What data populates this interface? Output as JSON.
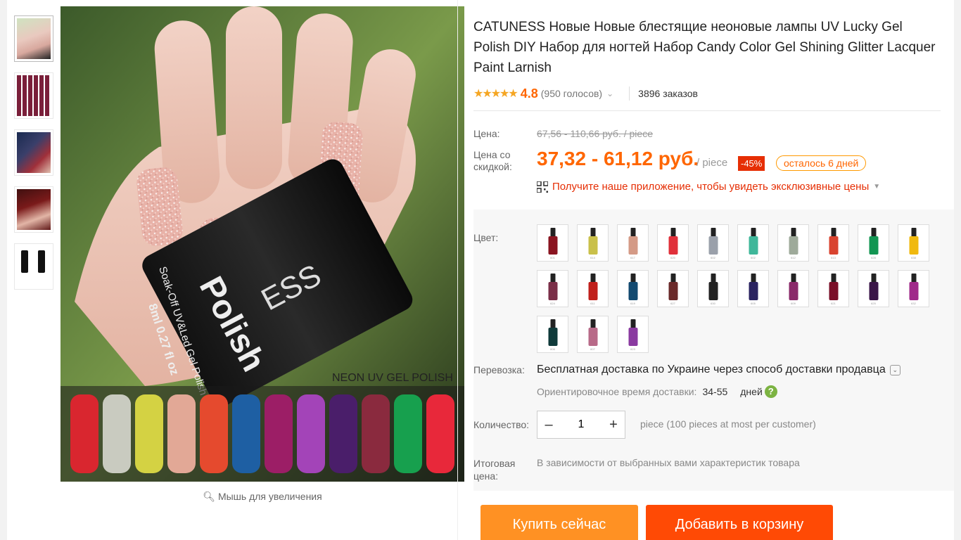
{
  "product": {
    "title": "CATUNESS Новые Новые блестящие неоновые лампы UV Lucky Gel Polish DIY Набор для ногтей Набор Candy Color Gel Shining Glitter Lacquer Paint Larnish",
    "rating": "4.8",
    "votes": "(950 голосов)",
    "orders": "3896 заказов"
  },
  "gallery": {
    "zoom_hint": "Мышь для увеличения",
    "image_caption": "NEON UV GEL POLISH",
    "bottle_text_1": "Soak-Off UV&Led Gel Polish",
    "bottle_text_2": "8ml 0.27 fl oz",
    "bottle_brand": "ESS",
    "bottle_word": "Polish",
    "thumbnails": [
      "hand-nails",
      "bottles-grid",
      "nails-red",
      "hand-dark",
      "two-bottles"
    ]
  },
  "price": {
    "label": "Цена:",
    "old": "67,56 - 110,66 руб. / piece",
    "discount_label": "Цена со скидкой:",
    "new": "37,32 - 61,12 руб.",
    "per_piece": "/ piece",
    "discount_pct": "-45%",
    "days_left": "осталось 6 дней",
    "app_promo": "Получите наше приложение, чтобы увидеть эксклюзивные цены"
  },
  "colors": {
    "label": "Цвет:",
    "swatches": [
      {
        "color": "#8a1420",
        "code": "601"
      },
      {
        "color": "#c9c04a",
        "code": "614"
      },
      {
        "color": "#d49a86",
        "code": "617"
      },
      {
        "color": "#e0303a",
        "code": "620"
      },
      {
        "color": "#9aa0aa",
        "code": "602"
      },
      {
        "color": "#3fb79a",
        "code": "602"
      },
      {
        "color": "#9eaa9a",
        "code": "612"
      },
      {
        "color": "#d9432f",
        "code": "613"
      },
      {
        "color": "#129552",
        "code": "628"
      },
      {
        "color": "#f0b90e",
        "code": "638"
      },
      {
        "color": "#7a2f48",
        "code": "624"
      },
      {
        "color": "#c0201c",
        "code": "611"
      },
      {
        "color": "#134a70",
        "code": "619"
      },
      {
        "color": "#6a2a2a",
        "code": "627"
      },
      {
        "color": "#222222",
        "code": "630"
      },
      {
        "color": "#2a2360",
        "code": "605"
      },
      {
        "color": "#8a2a6a",
        "code": "609"
      },
      {
        "color": "#7a0f28",
        "code": "621"
      },
      {
        "color": "#3a1648",
        "code": "625"
      },
      {
        "color": "#a02a8a",
        "code": "632"
      },
      {
        "color": "#0f3a3a",
        "code": "606"
      },
      {
        "color": "#b86a88",
        "code": "607"
      },
      {
        "color": "#8a3aa0",
        "code": "623"
      }
    ]
  },
  "shipping": {
    "label": "Перевозка:",
    "value": "Бесплатная доставка по Украине через способ доставки продавца",
    "delivery_label": "Ориентировочное время доставки:",
    "delivery_range": "34-55",
    "delivery_unit": "дней"
  },
  "quantity": {
    "label": "Количество:",
    "value": "1",
    "minus": "–",
    "plus": "+",
    "note": "piece (100 pieces at most per customer)"
  },
  "total": {
    "label": "Итоговая цена:",
    "note": "В зависимости от выбранных вами характеристик товара"
  },
  "actions": {
    "buy_now": "Купить сейчас",
    "add_to_cart": "Добавить в корзину"
  },
  "theme": {
    "accent": "#f60",
    "sale_red": "#e62e04",
    "star": "#f5a623"
  }
}
